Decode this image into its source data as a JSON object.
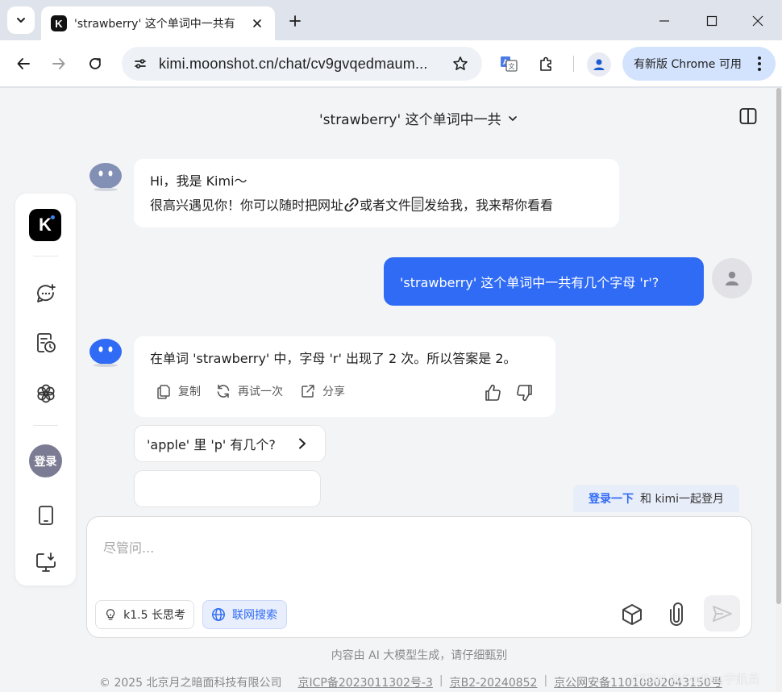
{
  "browser": {
    "tab_title": "'strawberry' 这个单词中一共有",
    "url": "kimi.moonshot.cn/chat/cv9gvqedmaum...",
    "update_label": "有新版 Chrome 可用"
  },
  "chat": {
    "title": "'strawberry' 这个单词中一共"
  },
  "sidebar": {
    "login_label": "登录"
  },
  "messages": {
    "greeting_line1": "Hi，我是 Kimi～",
    "greeting_line2a": "很高兴遇见你！你可以随时把网址",
    "greeting_line2b": "或者文件",
    "greeting_line2c": "发给我，我来帮你看看",
    "user_question": "'strawberry' 这个单词中一共有几个字母 'r'?",
    "bot_answer": "在单词 'strawberry' 中，字母 'r' 出现了 2 次。所以答案是 2。"
  },
  "actions": {
    "copy": "复制",
    "retry": "再试一次",
    "share": "分享"
  },
  "suggestions": [
    {
      "text": "'apple' 里 'p' 有几个?"
    },
    {
      "text": ""
    }
  ],
  "login_banner": {
    "link": "登录一下",
    "text": "和 kimi一起登月"
  },
  "input": {
    "placeholder": "尽管问...",
    "mode_k": "k1.5 长思考",
    "mode_web": "联网搜索"
  },
  "footer": {
    "disclaimer": "内容由 AI 大模型生成，请仔细甄别",
    "copyright": "© 2025 北京月之暗面科技有限公司",
    "icp": "京ICP备2023011302号-3",
    "b2": "京B2-20240852",
    "police": "京公网安备11010802043150号",
    "watermark": "CSDN @Coding宇航员"
  },
  "colors": {
    "accent": "#2f6bf5",
    "page_bg": "#f3f4f6",
    "chrome_bg": "#dfe3eb"
  }
}
